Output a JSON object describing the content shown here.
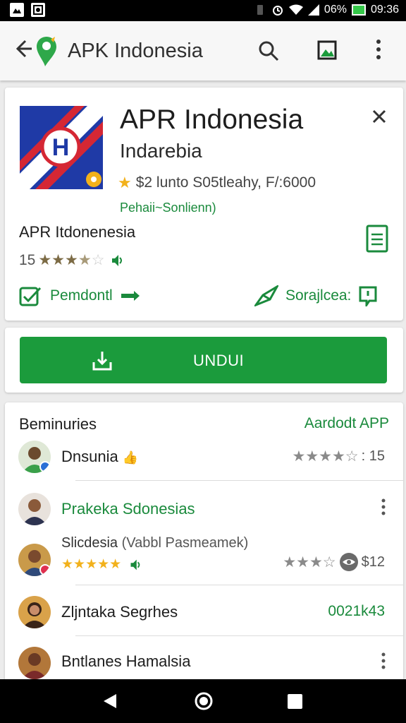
{
  "status": {
    "battery_text": "06%",
    "time": "09:36"
  },
  "appbar": {
    "title": "APK Indonesia"
  },
  "app_card": {
    "title": "APR Indonesia",
    "subtitle": "Indarebia",
    "meta": "$2 lunto S05tleahy, F/:6000",
    "developer": "Pehaii~Sonlienn)",
    "name": "APR Itdonenesia",
    "rating_count": "15",
    "action_left": "Pemdontl",
    "action_right": "Sorajlcea:"
  },
  "download": {
    "label": "UNDUI"
  },
  "reviews": {
    "header": "Beminuries",
    "link": "Aardodt APP",
    "rows": [
      {
        "name": "Dnsunia",
        "right": ": 15"
      },
      {
        "name": "Prakeka Sdonesias"
      },
      {
        "name": "Slicdesia",
        "sub": "(Vabbl Pasmeamek)",
        "right": "$12"
      },
      {
        "name": "Zljntaka Segrhes",
        "right": "0021k43"
      },
      {
        "name": "Bntlanes Hamalsia"
      }
    ]
  },
  "colors": {
    "accent": "#1b9b3c",
    "star_gold": "#f2b11b"
  }
}
